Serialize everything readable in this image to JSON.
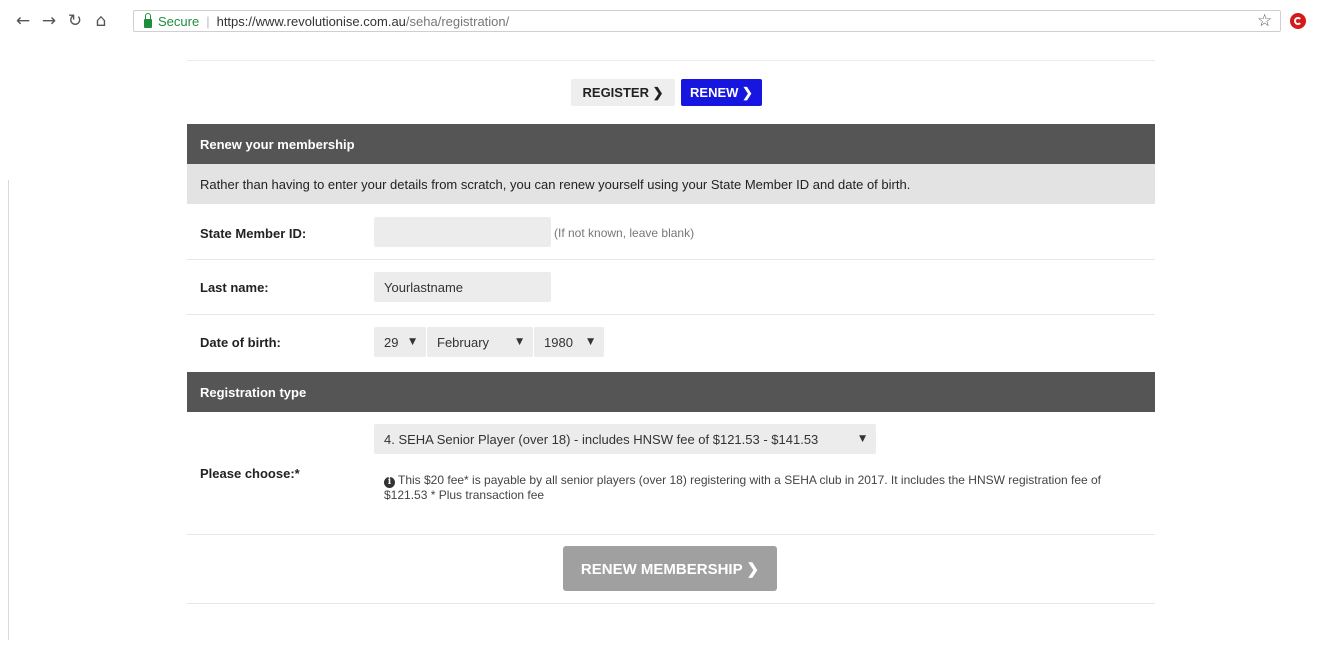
{
  "browser": {
    "secure_label": "Secure",
    "url_domain": "https://www.revolutionise.com.au",
    "url_path": "/seha/registration/"
  },
  "toggle": {
    "register_label": "REGISTER ❯",
    "renew_label": "RENEW ❯"
  },
  "renew_section": {
    "title": "Renew your membership",
    "intro": "Rather than having to enter your details from scratch, you can renew yourself using your State Member ID and date of birth."
  },
  "form": {
    "member_id": {
      "label": "State Member ID:",
      "value": "",
      "hint": "(If not known, leave blank)"
    },
    "last_name": {
      "label": "Last name:",
      "value": "Yourlastname"
    },
    "dob": {
      "label": "Date of birth:",
      "day": "29",
      "month": "February",
      "year": "1980"
    }
  },
  "registration_section": {
    "title": "Registration type",
    "choose_label": "Please choose:*",
    "selected_option": "4. SEHA Senior Player (over 18) - includes HNSW fee of $121.53 - $141.53",
    "note": "This $20 fee* is payable by all senior players (over 18) registering with a SEHA club in 2017. It includes the HNSW registration fee of $121.53 * Plus transaction fee"
  },
  "submit": {
    "label": "RENEW MEMBERSHIP ❯"
  },
  "colors": {
    "renew_blue": "#1616e0",
    "header_grey": "#555555",
    "submit_grey": "#a0a0a0"
  }
}
